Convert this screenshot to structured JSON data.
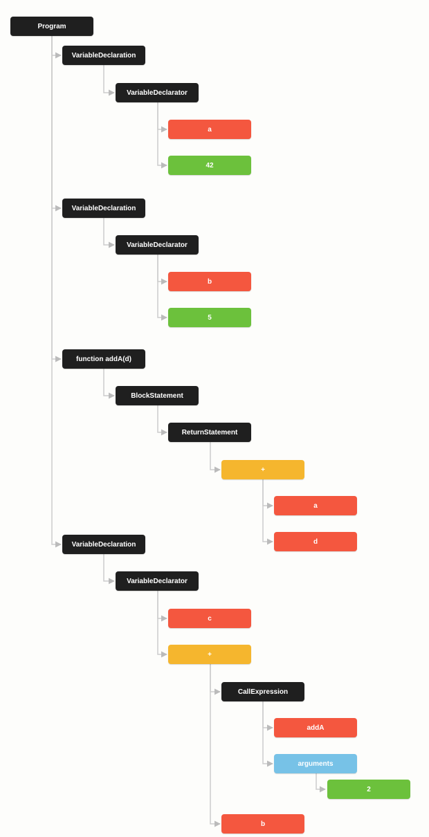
{
  "tree": {
    "program": "Program",
    "vd1": "VariableDeclaration",
    "vd1_declr": "VariableDeclarator",
    "vd1_id_a": "a",
    "vd1_val_42": "42",
    "vd2": "VariableDeclaration",
    "vd2_declr": "VariableDeclarator",
    "vd2_id_b": "b",
    "vd2_val_5": "5",
    "func": "function addA(d)",
    "block": "BlockStatement",
    "ret": "ReturnStatement",
    "plus1": "+",
    "plus1_a": "a",
    "plus1_d": "d",
    "vd3": "VariableDeclaration",
    "vd3_declr": "VariableDeclarator",
    "vd3_id_c": "c",
    "plus2": "+",
    "callexpr": "CallExpression",
    "call_addA": "addA",
    "call_args": "arguments",
    "arg_2": "2",
    "plus2_b": "b"
  }
}
